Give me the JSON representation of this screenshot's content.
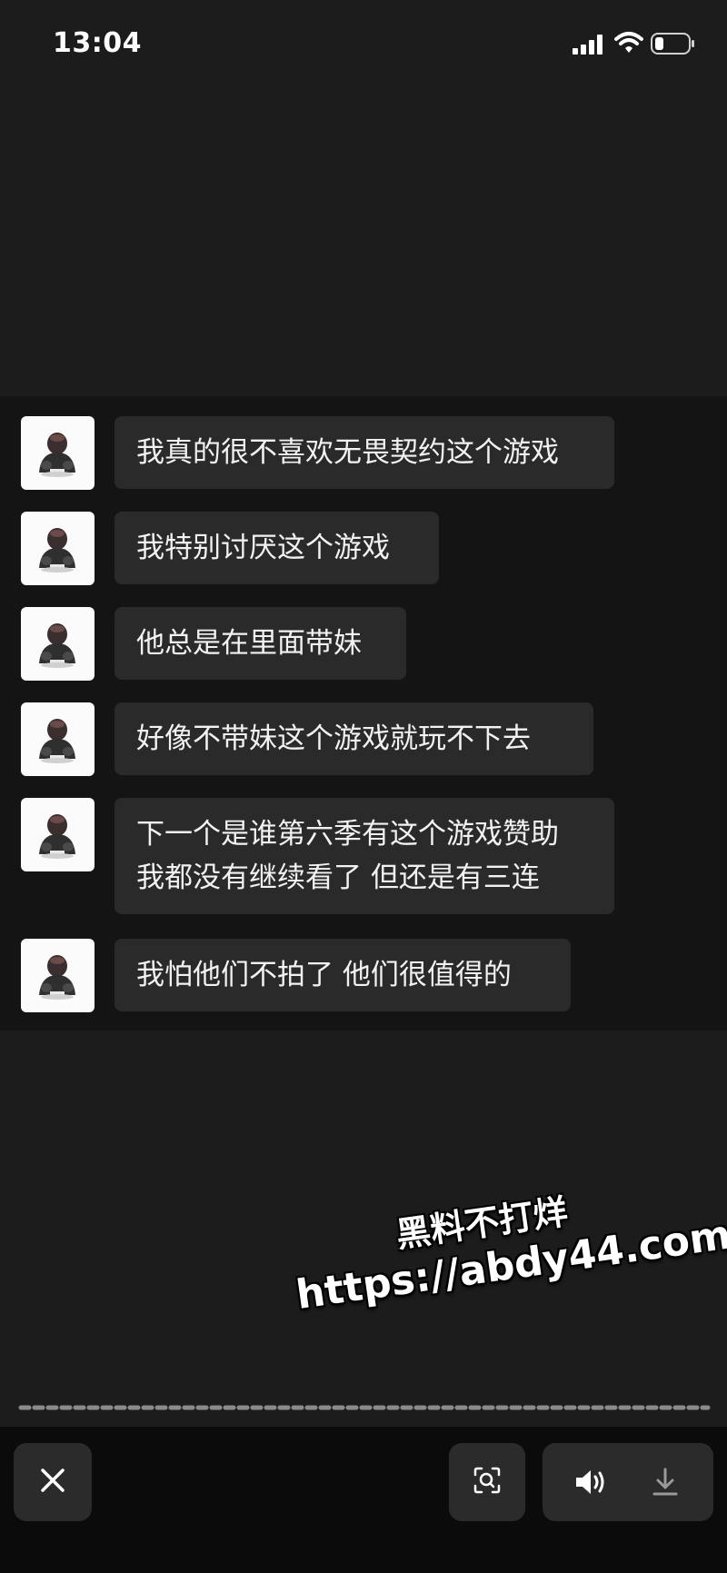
{
  "status_bar": {
    "time": "13:04",
    "icons": [
      "signal-icon",
      "wifi-icon",
      "battery-icon"
    ]
  },
  "messages": [
    {
      "lines": [
        "我真的很不喜欢无畏契约这个游戏"
      ]
    },
    {
      "lines": [
        "我特别讨厌这个游戏"
      ]
    },
    {
      "lines": [
        "他总是在里面带妹"
      ]
    },
    {
      "lines": [
        "好像不带妹这个游戏就玩不下去"
      ]
    },
    {
      "lines": [
        "下一个是谁第六季有这个游戏赞助",
        "我都没有继续看了 但还是有三连"
      ]
    },
    {
      "lines": [
        "我怕他们不拍了 他们很值得的"
      ]
    }
  ],
  "watermark": {
    "line1": "黑料不打烊",
    "line2": "https://abdy44.com"
  },
  "playback": {
    "progress": 0.0
  },
  "toolbar": {
    "icons": [
      "close-icon",
      "scan-icon",
      "volume-icon",
      "download-icon"
    ]
  },
  "colors": {
    "background": "#1c1c1c",
    "chat_panel": "#141414",
    "bubble": "#2a2a2a",
    "bottom_bar": "#0b0b0b"
  }
}
